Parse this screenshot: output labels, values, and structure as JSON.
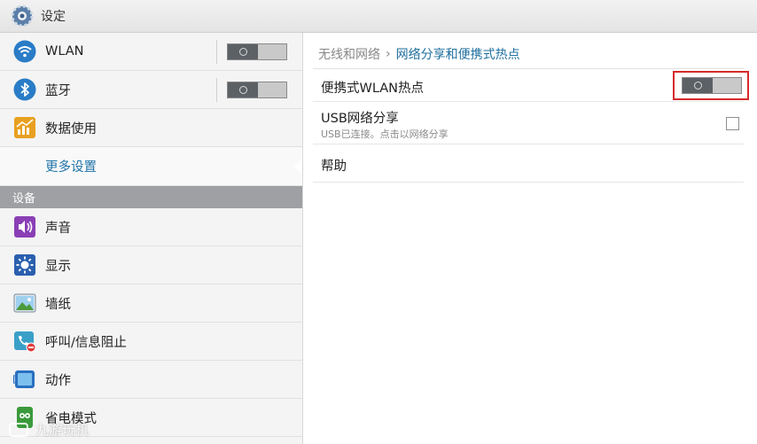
{
  "titlebar": {
    "title": "设定",
    "icon": "gear-icon"
  },
  "sidebar": {
    "wireless": [
      {
        "label": "WLAN",
        "icon": "wifi-icon",
        "toggle": "off"
      },
      {
        "label": "蓝牙",
        "icon": "bluetooth-icon",
        "toggle": "off"
      },
      {
        "label": "数据使用",
        "icon": "data-usage-icon"
      },
      {
        "label": "更多设置",
        "selected": true
      }
    ],
    "device_header": "设备",
    "device": [
      {
        "label": "声音",
        "icon": "sound-icon"
      },
      {
        "label": "显示",
        "icon": "display-icon"
      },
      {
        "label": "墙纸",
        "icon": "wallpaper-icon"
      },
      {
        "label": "呼叫/信息阻止",
        "icon": "call-block-icon"
      },
      {
        "label": "动作",
        "icon": "motion-icon"
      },
      {
        "label": "省电模式",
        "icon": "power-saving-icon"
      }
    ]
  },
  "breadcrumb": {
    "parent": "无线和网络",
    "separator": "›",
    "current": "网络分享和便携式热点"
  },
  "settings": {
    "hotspot": {
      "label": "便携式WLAN热点",
      "toggle": "off",
      "highlighted": true
    },
    "usb": {
      "label": "USB网络分享",
      "sublabel": "USB已连接。点击以网络分享",
      "checked": false
    },
    "help": {
      "label": "帮助"
    }
  },
  "watermark": "九游玩机",
  "colors": {
    "accent": "#1f73a8",
    "highlight": "#d62a2a",
    "section_header": "#9ea0a3"
  }
}
